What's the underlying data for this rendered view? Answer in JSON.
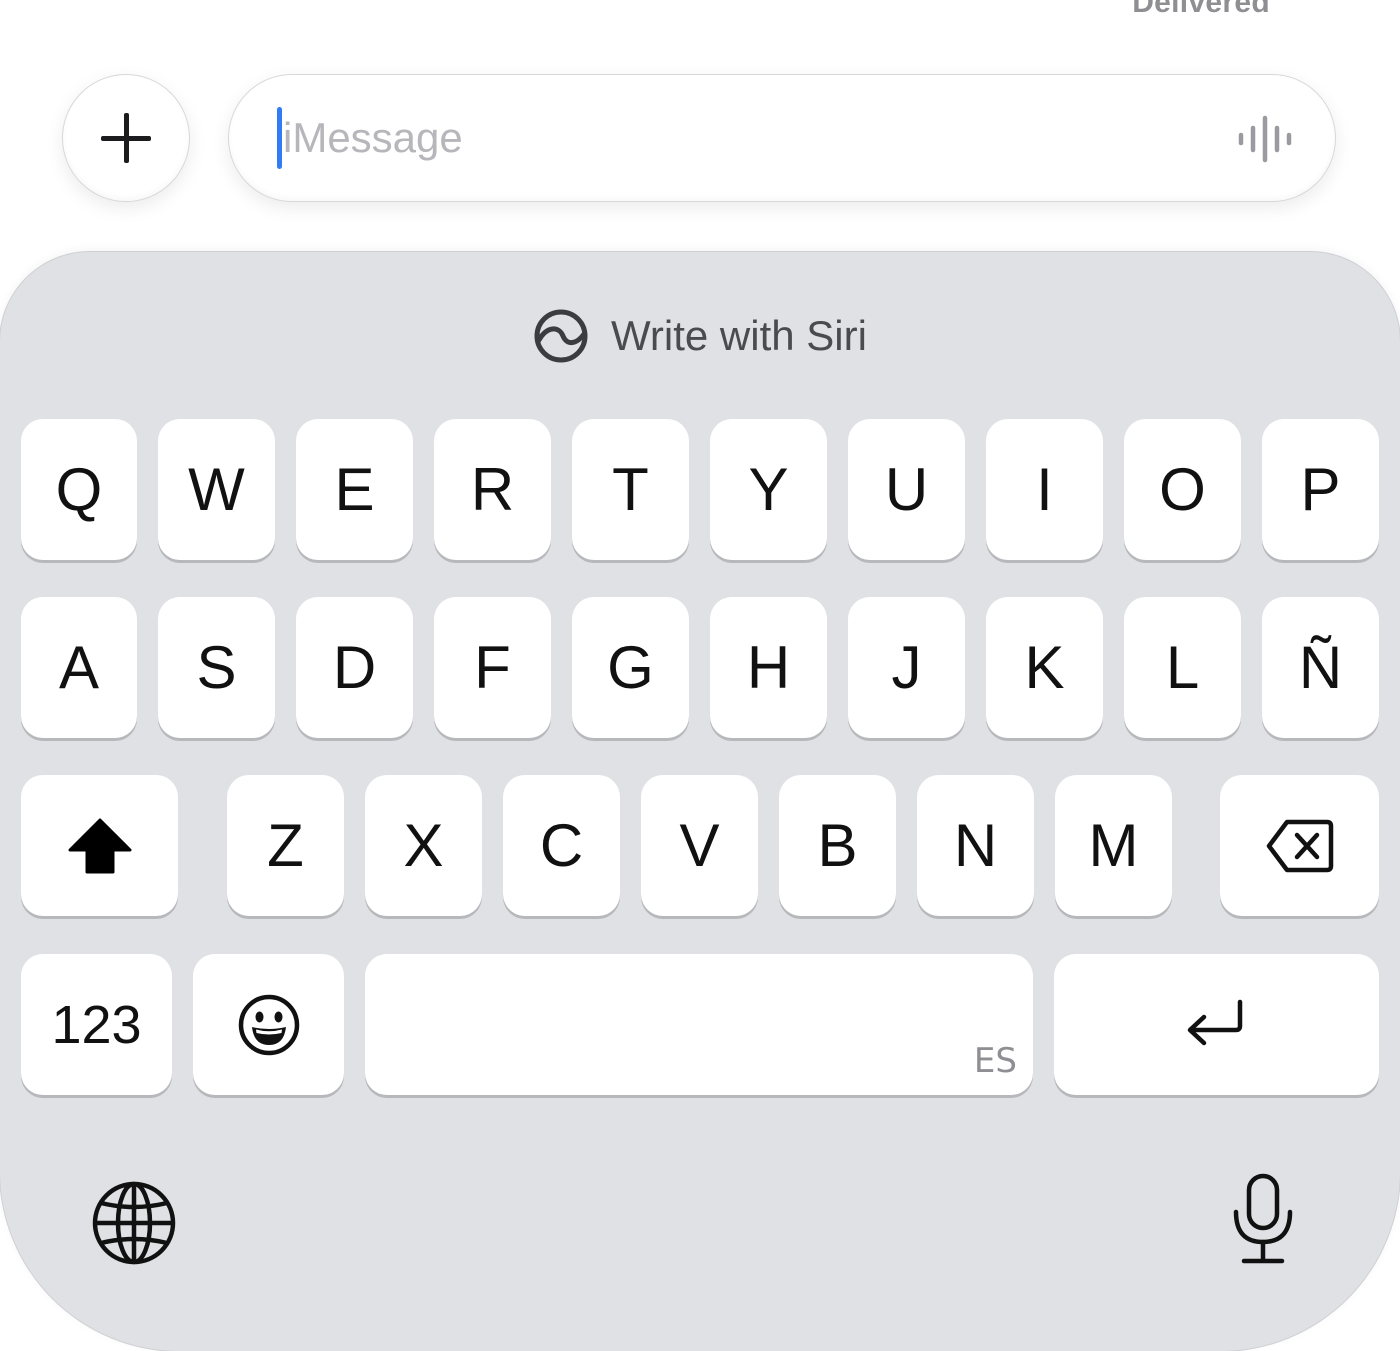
{
  "status": {
    "delivered": "Delivered"
  },
  "composer": {
    "add_label": "+",
    "placeholder": "iMessage",
    "audio_icon": "waveform-icon"
  },
  "keyboard": {
    "siri_label": "Write with Siri",
    "siri_icon": "siri-icon",
    "rows": [
      [
        "Q",
        "W",
        "E",
        "R",
        "T",
        "Y",
        "U",
        "I",
        "O",
        "P"
      ],
      [
        "A",
        "S",
        "D",
        "F",
        "G",
        "H",
        "J",
        "K",
        "L",
        "Ñ"
      ],
      [
        "Z",
        "X",
        "C",
        "V",
        "B",
        "N",
        "M"
      ]
    ],
    "shift_icon": "shift-icon",
    "delete_icon": "delete-icon",
    "numbers_label": "123",
    "emoji_icon": "emoji-icon",
    "space_language": "ES",
    "return_icon": "return-icon",
    "globe_icon": "globe-icon",
    "dictation_icon": "microphone-icon"
  },
  "colors": {
    "keyboard_bg": "#e0e1e5",
    "key_bg": "#ffffff",
    "caret": "#2f7cf6",
    "placeholder": "#b6b6bb"
  }
}
